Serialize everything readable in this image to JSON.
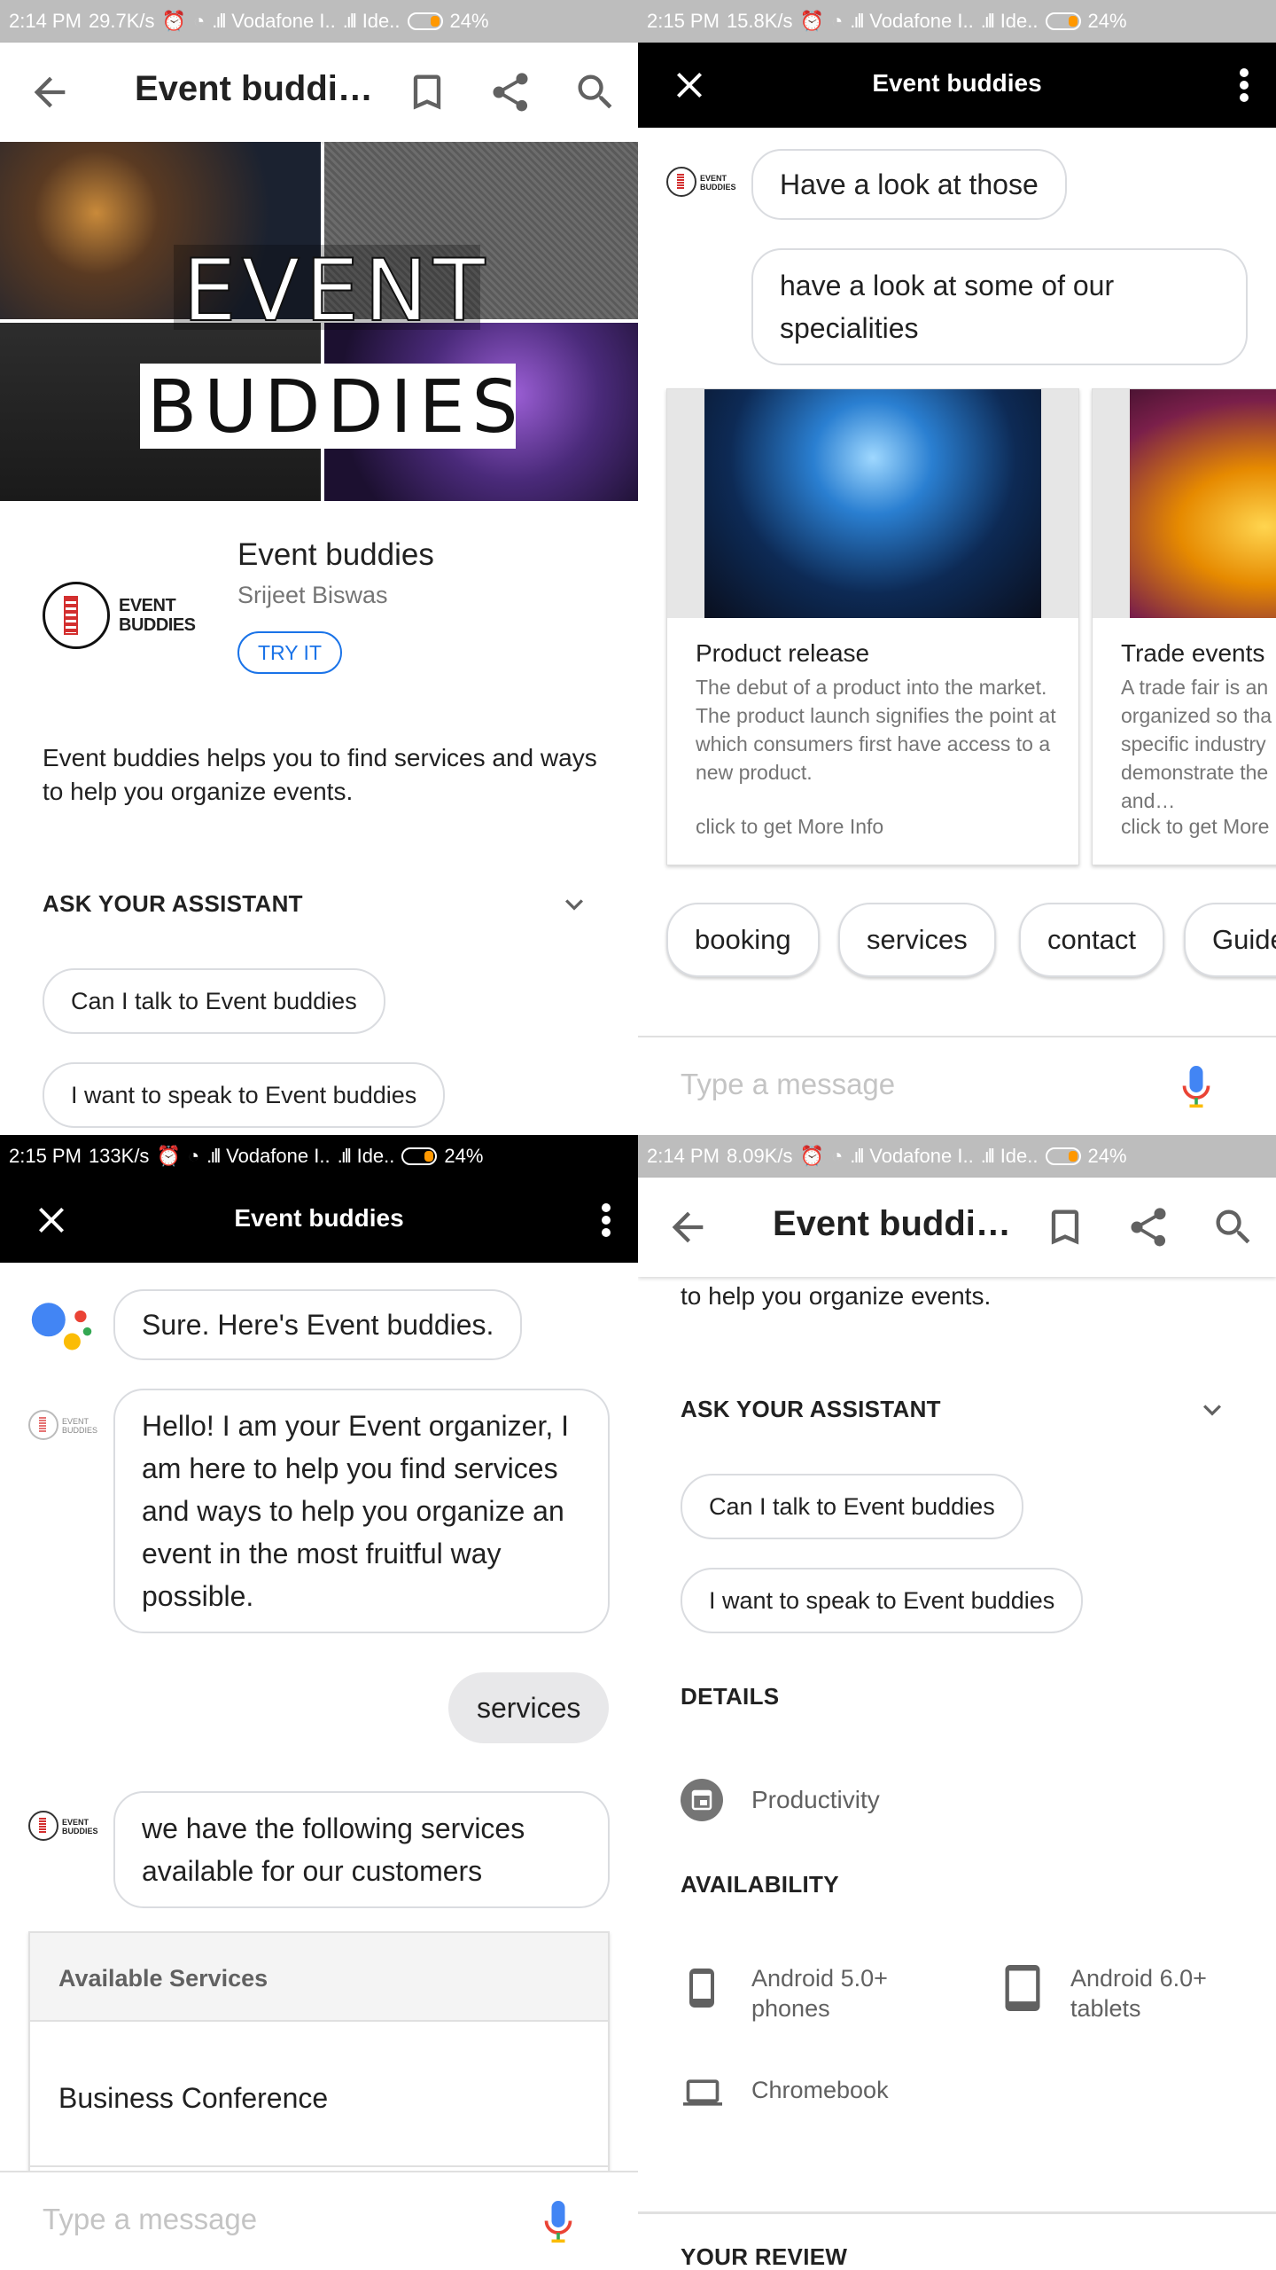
{
  "panels": {
    "store_top": {
      "status": {
        "time": "2:14 PM",
        "speed": "29.7K/s",
        "carrier1": "Vodafone I..",
        "carrier2": "Ide..",
        "battery": "24%"
      },
      "title": "Event buddi…",
      "banner": {
        "line1": "EVENT",
        "line2": "BUDDIES"
      },
      "logo_text": {
        "line1": "EVENT",
        "line2": "BUDDIES"
      },
      "app_name": "Event buddies",
      "developer": "Srijeet Biswas",
      "try_button": "TRY IT",
      "description": "Event buddies helps you to find services and ways to help you organize events.",
      "ask_heading": "ASK YOUR ASSISTANT",
      "suggestions": [
        "Can I talk to Event buddies",
        "I want to speak to Event buddies"
      ]
    },
    "chat_cards": {
      "status": {
        "time": "2:15 PM",
        "speed": "15.8K/s",
        "carrier1": "Vodafone I..",
        "carrier2": "Ide..",
        "battery": "24%"
      },
      "title": "Event buddies",
      "logo_text": {
        "line1": "EVENT",
        "line2": "BUDDIES"
      },
      "bubble1": "Have a look at those",
      "bubble2": "have a look at  some of  our specialities",
      "cards": [
        {
          "title": "Product release",
          "description": "The debut of a product into the market. The product launch signifies the point at which consumers first have access to a new product.",
          "link": "click to get More Info"
        },
        {
          "title": "Trade events",
          "description": "A trade fair is an organized so tha specific industry demonstrate the and…",
          "link": "click to get More"
        }
      ],
      "chips": [
        "booking",
        "services",
        "contact",
        "Guide"
      ],
      "input_placeholder": "Type a message"
    },
    "chat_services": {
      "status": {
        "time": "2:15 PM",
        "speed": "133K/s",
        "carrier1": "Vodafone I..",
        "carrier2": "Ide..",
        "battery": "24%"
      },
      "title": "Event buddies",
      "logo_text": {
        "line1": "EVENT",
        "line2": "BUDDIES"
      },
      "assistant_msg": "Sure. Here's Event buddies.",
      "bot_msg1": "Hello! I am your Event organizer, I am here to help you find services and ways to help you organize an event in the most fruitful way possible.",
      "user_msg": "services",
      "bot_msg2": "we have the following services available for our customers",
      "list_header": "Available Services",
      "list_items": [
        "Business Conference"
      ],
      "input_placeholder": "Type a message"
    },
    "store_bottom": {
      "status": {
        "time": "2:14 PM",
        "speed": "8.09K/s",
        "carrier1": "Vodafone I..",
        "carrier2": "Ide..",
        "battery": "24%"
      },
      "title": "Event buddi…",
      "desc_tail": "to help you organize events.",
      "ask_heading": "ASK YOUR ASSISTANT",
      "suggestions": [
        "Can I talk to Event buddies",
        "I want to speak to Event buddies"
      ],
      "details_heading": "DETAILS",
      "category": "Productivity",
      "availability_heading": "AVAILABILITY",
      "platforms": [
        "Android 5.0+ phones",
        "Android 6.0+ tablets",
        "Chromebook"
      ],
      "review_heading": "YOUR REVIEW"
    }
  },
  "colors": {
    "accent_blue": "#1a73e8",
    "chip_border": "#dadce0",
    "muted_text": "#757575",
    "battery_orange": "#ff9800"
  },
  "icons": [
    "back-arrow-icon",
    "bookmark-icon",
    "share-icon",
    "search-icon",
    "close-icon",
    "more-vert-icon",
    "chevron-down-icon",
    "mic-icon",
    "google-assistant-icon",
    "productivity-icon",
    "phone-icon",
    "tablet-icon",
    "laptop-icon"
  ]
}
